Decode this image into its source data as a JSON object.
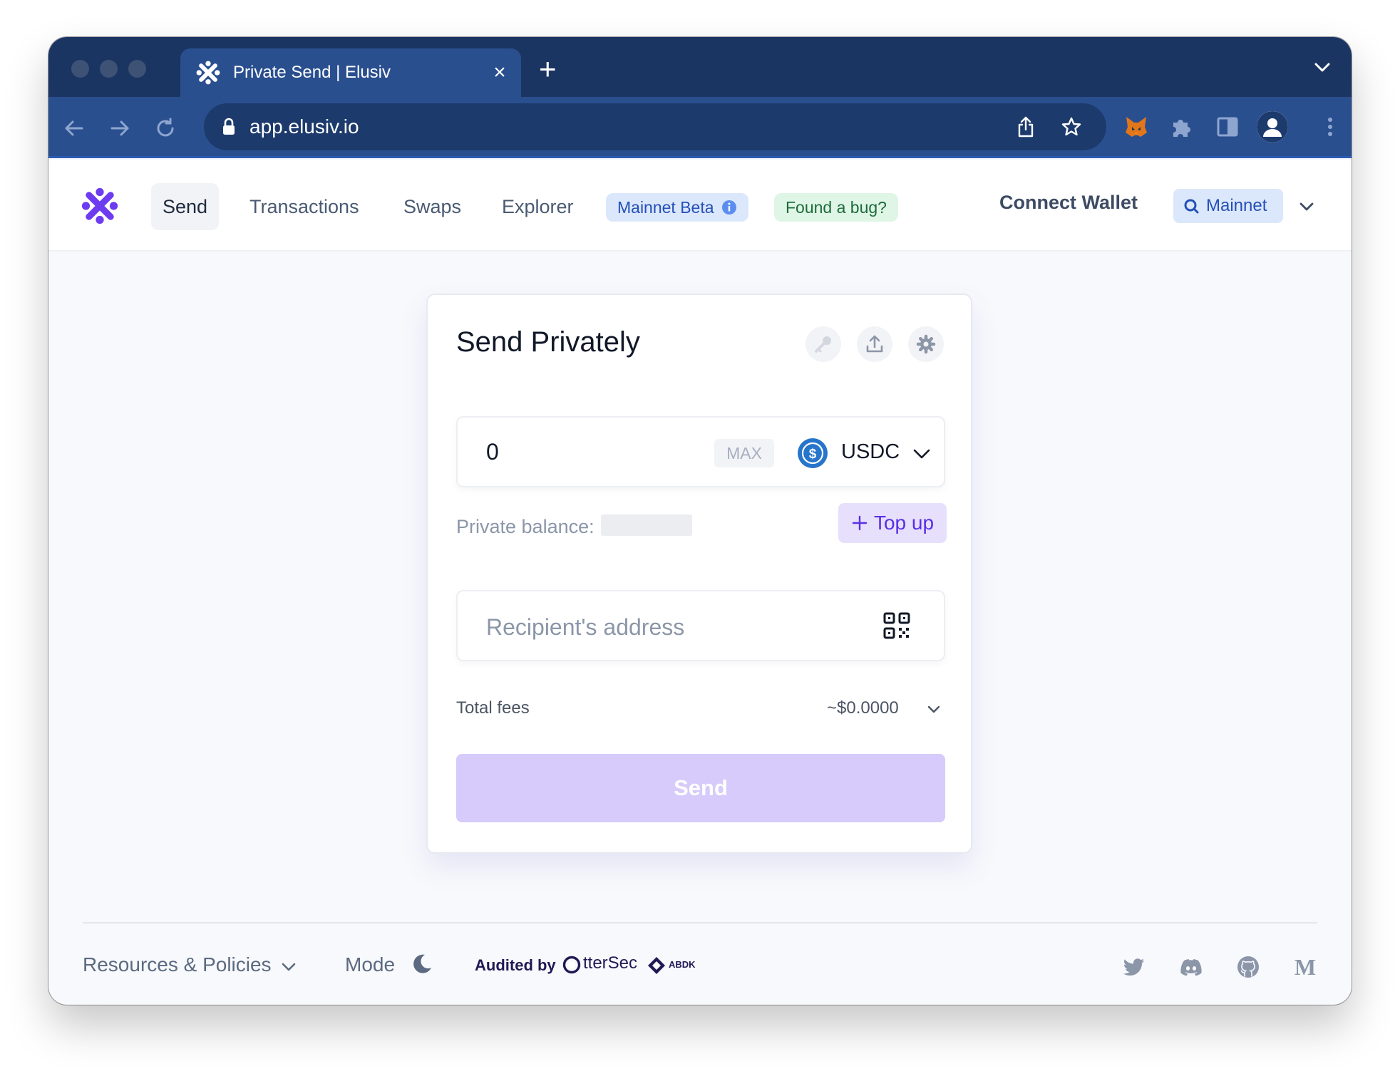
{
  "browser": {
    "tab_title": "Private Send | Elusiv",
    "tab_close": "×",
    "new_tab": "+",
    "url": "app.elusiv.io"
  },
  "header": {
    "nav": [
      {
        "label": "Send"
      },
      {
        "label": "Transactions"
      },
      {
        "label": "Swaps"
      },
      {
        "label": "Explorer"
      }
    ],
    "beta_badge": "Mainnet Beta",
    "bug_badge": "Found a bug?",
    "connect_wallet": "Connect Wallet",
    "network": "Mainnet"
  },
  "card": {
    "title": "Send Privately",
    "amount": "0",
    "max_label": "MAX",
    "token": "USDC",
    "balance_label": "Private balance:",
    "topup_label": "Top up",
    "recipient_placeholder": "Recipient's address",
    "fees_label": "Total fees",
    "fees_value": "~$0.0000",
    "send_label": "Send"
  },
  "footer": {
    "resources": "Resources & Policies",
    "mode": "Mode",
    "audited_by": "Audited by",
    "auditor_1": "tterSec",
    "auditor_2": "ABDK"
  },
  "colors": {
    "brand": "#6d3bf0",
    "chrome_dark": "#1b3563",
    "chrome": "#2a4f8f",
    "send_disabled": "#d6cbfb",
    "topup_bg": "#e6e0fc",
    "network_bg": "#dbe7fb"
  },
  "icons": [
    "elusiv-logo-icon",
    "close-icon",
    "plus-icon",
    "back-icon",
    "forward-icon",
    "reload-icon",
    "lock-icon",
    "share-icon",
    "star-icon",
    "fox-extension-icon",
    "puzzle-icon",
    "sidebar-icon",
    "profile-icon",
    "kebab-menu-icon",
    "info-icon",
    "search-icon",
    "chevron-down-icon",
    "key-icon",
    "upload-icon",
    "gear-icon",
    "usdc-icon",
    "qr-code-icon",
    "moon-icon",
    "twitter-icon",
    "discord-icon",
    "github-icon",
    "medium-icon"
  ]
}
